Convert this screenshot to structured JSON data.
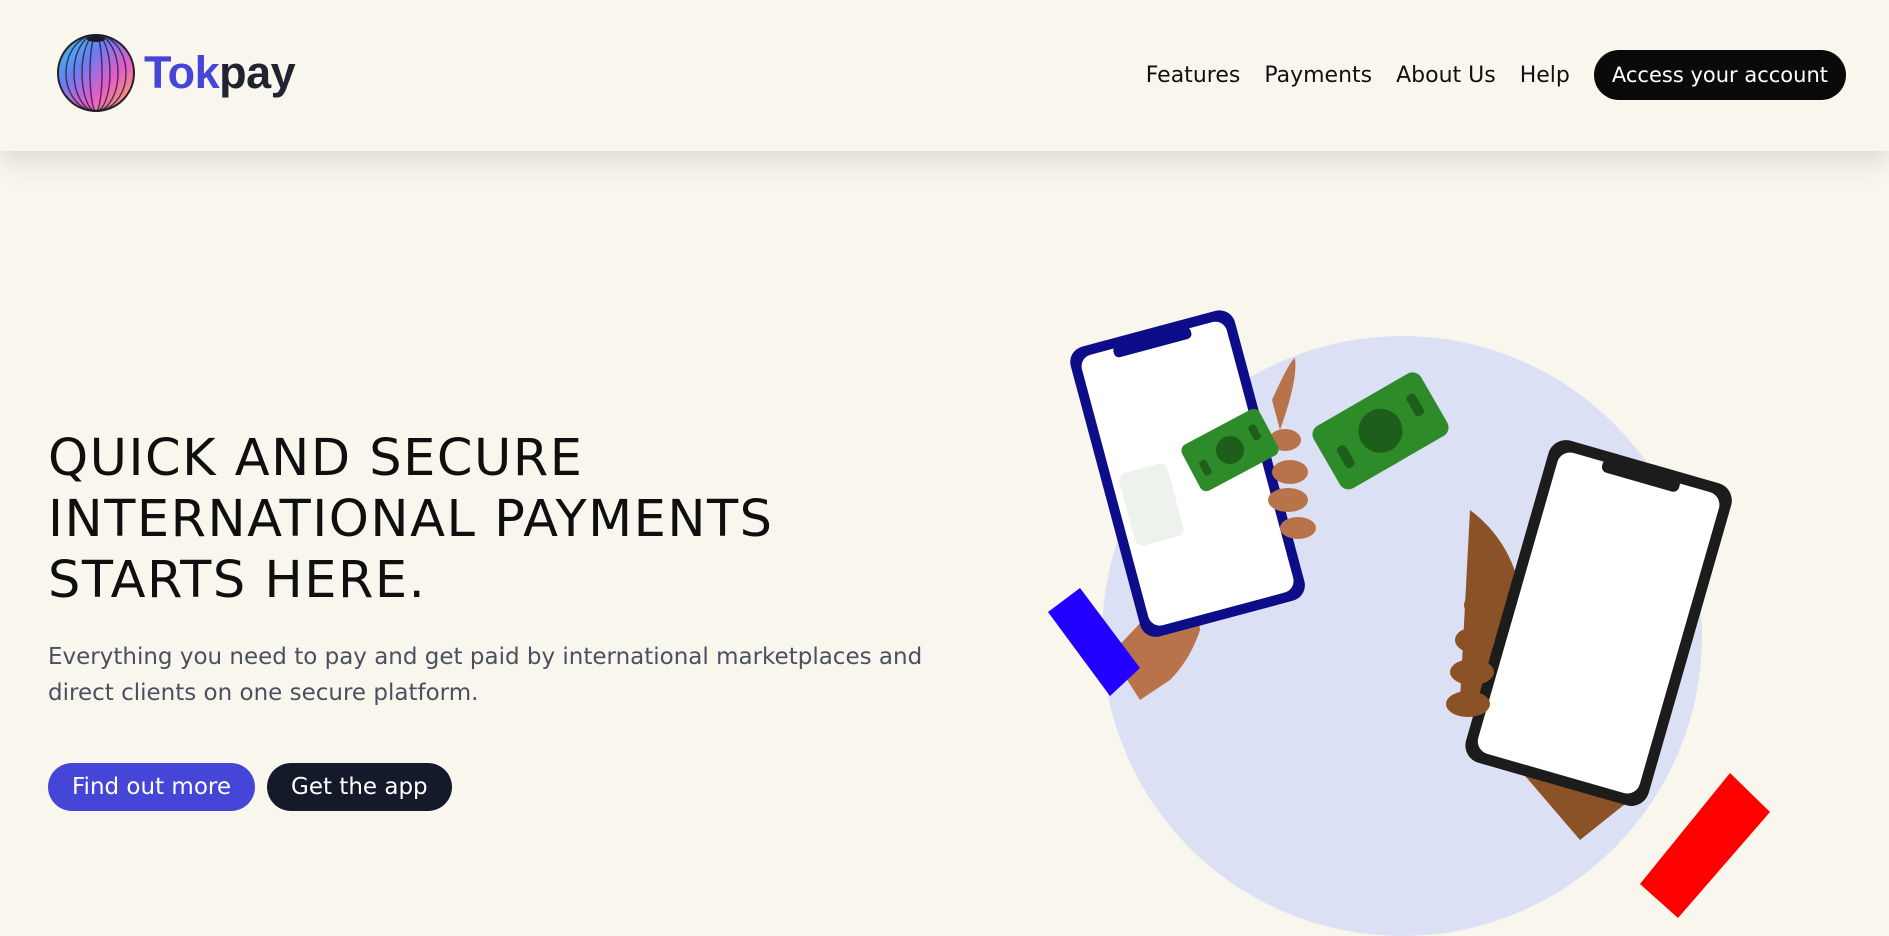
{
  "header": {
    "brand": {
      "part1": "Tok",
      "part2": "pay",
      "icon": "globe-logo-icon"
    },
    "nav": [
      {
        "label": "Features"
      },
      {
        "label": "Payments"
      },
      {
        "label": "About Us"
      },
      {
        "label": "Help"
      }
    ],
    "cta_label": "Access your account"
  },
  "hero": {
    "headline_lines": [
      "QUICK AND SECURE",
      "INTERNATIONAL PAYMENTS",
      "STARTS HERE."
    ],
    "subtext": "Everything you need to pay and get paid by international marketplaces and direct clients on one secure platform.",
    "primary_button": "Find out more",
    "secondary_button": "Get the app"
  },
  "illustration": {
    "icons": [
      "phone-icon",
      "banknote-icon",
      "hand-icon"
    ]
  },
  "colors": {
    "background": "#f9f6ee",
    "brand_primary": "#4546d8",
    "dark": "#141a2a",
    "accent_circle": "#dbe0f4",
    "money_green": "#2e8b2a",
    "sleeve_blue": "#2200ff",
    "sleeve_red": "#ff0000"
  }
}
